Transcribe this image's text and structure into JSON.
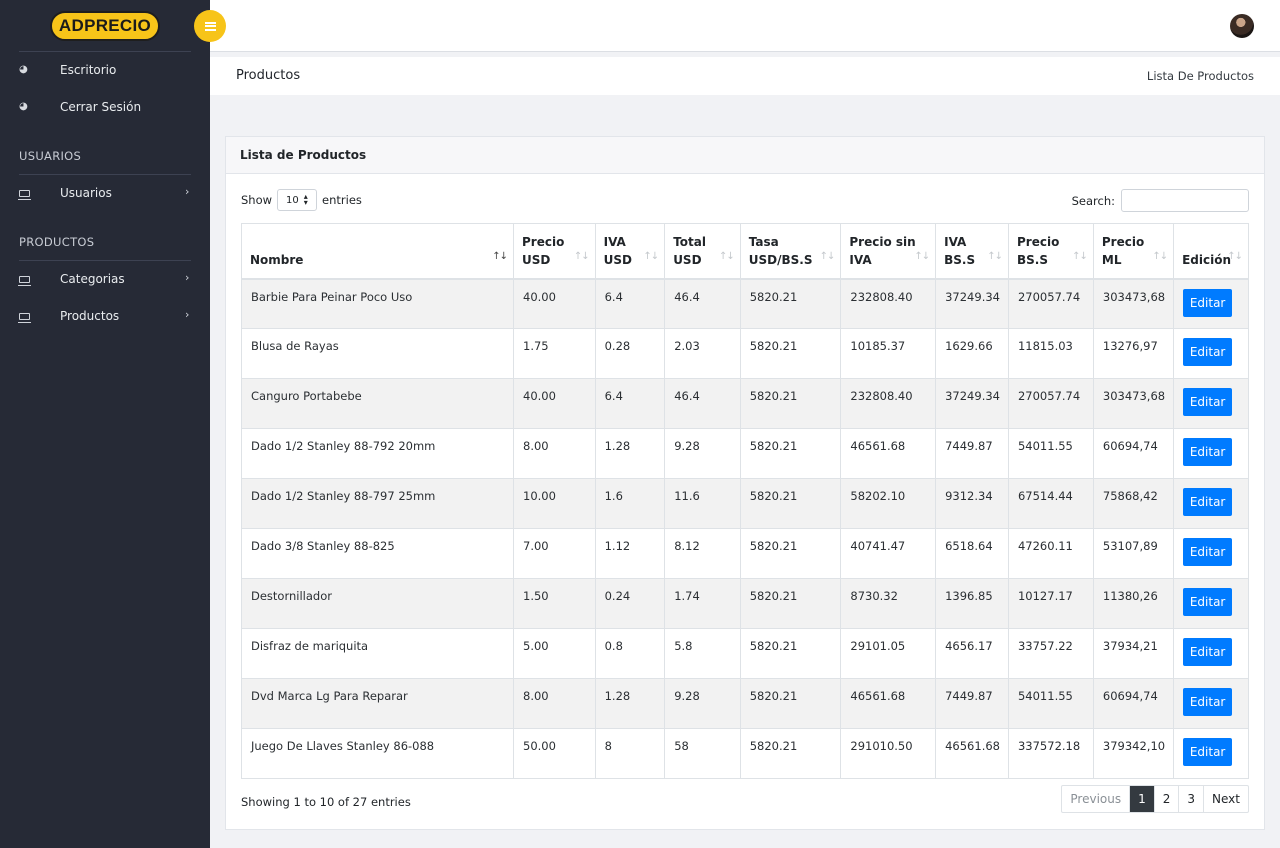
{
  "brand": {
    "logo_text": "ADPRECIO",
    "accent": "#f7c419",
    "sidebar_bg": "#262a36",
    "button_color": "#007bff"
  },
  "sidebar": {
    "items_top": [
      {
        "label": "Escritorio",
        "icon": "dashboard-icon"
      },
      {
        "label": "Cerrar Sesión",
        "icon": "dashboard-icon"
      }
    ],
    "section_users": "USUARIOS",
    "users_item": {
      "label": "Usuarios",
      "icon": "monitor-icon"
    },
    "section_products": "PRODUCTOS",
    "products_items": [
      {
        "label": "Categorias",
        "icon": "monitor-icon"
      },
      {
        "label": "Productos",
        "icon": "monitor-icon"
      }
    ]
  },
  "header": {
    "page_title": "Productos",
    "breadcrumb": "Lista De Productos"
  },
  "card": {
    "title": "Lista de Productos"
  },
  "table_controls": {
    "show_label": "Show",
    "entries_label": "entries",
    "length_value": "10",
    "search_label": "Search:",
    "search_value": ""
  },
  "table": {
    "columns": [
      "Nombre",
      "Precio USD",
      "IVA USD",
      "Total USD",
      "Tasa USD/BS.S",
      "Precio sin IVA",
      "IVA BS.S",
      "Precio BS.S",
      "Precio ML",
      "Edición"
    ],
    "column_lines": [
      [
        "Nombre"
      ],
      [
        "Precio",
        "USD"
      ],
      [
        "IVA",
        "USD"
      ],
      [
        "Total",
        "USD"
      ],
      [
        "Tasa",
        "USD/BS.S"
      ],
      [
        "Precio sin",
        "IVA"
      ],
      [
        "IVA",
        "BS.S"
      ],
      [
        "Precio",
        "BS.S"
      ],
      [
        "Precio",
        "ML"
      ],
      [
        "Edición"
      ]
    ],
    "edit_label": "Editar",
    "rows": [
      [
        "Barbie Para Peinar Poco Uso",
        "40.00",
        "6.4",
        "46.4",
        "5820.21",
        "232808.40",
        "37249.34",
        "270057.74",
        "303473,68"
      ],
      [
        "Blusa de Rayas",
        "1.75",
        "0.28",
        "2.03",
        "5820.21",
        "10185.37",
        "1629.66",
        "11815.03",
        "13276,97"
      ],
      [
        "Canguro Portabebe",
        "40.00",
        "6.4",
        "46.4",
        "5820.21",
        "232808.40",
        "37249.34",
        "270057.74",
        "303473,68"
      ],
      [
        "Dado 1/2 Stanley 88-792 20mm",
        "8.00",
        "1.28",
        "9.28",
        "5820.21",
        "46561.68",
        "7449.87",
        "54011.55",
        "60694,74"
      ],
      [
        "Dado 1/2 Stanley 88-797 25mm",
        "10.00",
        "1.6",
        "11.6",
        "5820.21",
        "58202.10",
        "9312.34",
        "67514.44",
        "75868,42"
      ],
      [
        "Dado 3/8 Stanley 88-825",
        "7.00",
        "1.12",
        "8.12",
        "5820.21",
        "40741.47",
        "6518.64",
        "47260.11",
        "53107,89"
      ],
      [
        "Destornillador",
        "1.50",
        "0.24",
        "1.74",
        "5820.21",
        "8730.32",
        "1396.85",
        "10127.17",
        "11380,26"
      ],
      [
        "Disfraz de mariquita",
        "5.00",
        "0.8",
        "5.8",
        "5820.21",
        "29101.05",
        "4656.17",
        "33757.22",
        "37934,21"
      ],
      [
        "Dvd Marca Lg Para Reparar",
        "8.00",
        "1.28",
        "9.28",
        "5820.21",
        "46561.68",
        "7449.87",
        "54011.55",
        "60694,74"
      ],
      [
        "Juego De Llaves Stanley 86-088",
        "50.00",
        "8",
        "58",
        "5820.21",
        "291010.50",
        "46561.68",
        "337572.18",
        "379342,10"
      ]
    ]
  },
  "footer": {
    "info": "Showing 1 to 10 of 27 entries",
    "pagination": [
      "Previous",
      "1",
      "2",
      "3",
      "Next"
    ],
    "active_page": "1"
  }
}
